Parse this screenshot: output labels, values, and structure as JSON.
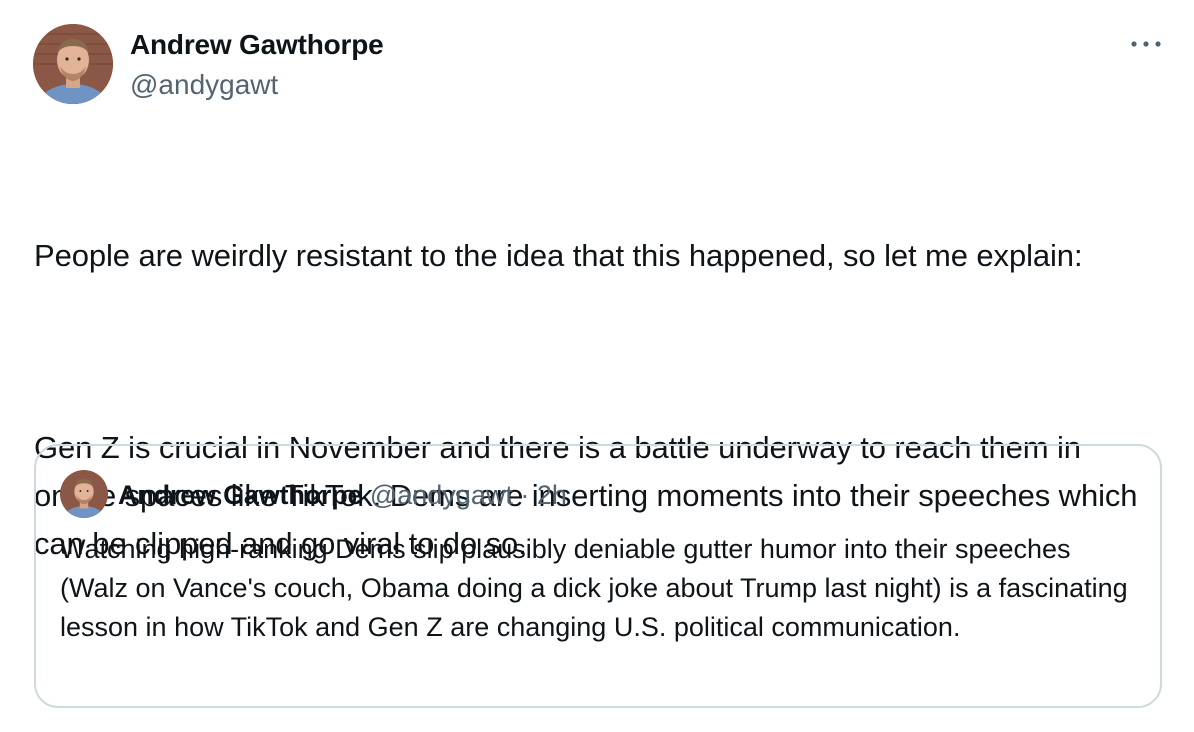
{
  "tweet": {
    "author": {
      "name": "Andrew Gawthorpe",
      "handle": "@andygawt"
    },
    "more_icon": "more-horizontal-icon",
    "text_paragraphs": [
      "People are weirdly resistant to the idea that this happened, so let me explain:",
      "Gen Z is crucial in November and there is a battle underway to reach them in online spaces like TikTok. Dems are inserting moments into their speeches which can be clipped and go viral to do so."
    ],
    "quoted": {
      "author_name": "Andrew Gawthorpe",
      "handle": "@andygawt",
      "separator": "·",
      "time": "2h",
      "text": "Watching high-ranking Dems slip plausibly deniable gutter humor into their speeches (Walz on Vance's couch, Obama doing a dick joke about Trump last night) is a fascinating lesson in how TikTok and Gen Z are changing U.S. political communication."
    }
  },
  "colors": {
    "text_primary": "#0f1419",
    "text_secondary": "#536471",
    "border": "#cfd9de"
  }
}
